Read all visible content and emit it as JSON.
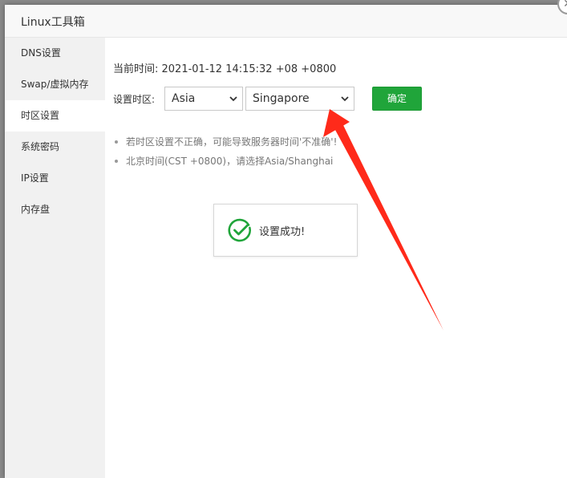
{
  "window": {
    "title": "Linux工具箱",
    "close_glyph": "✕"
  },
  "sidebar": {
    "items": [
      {
        "label": "DNS设置"
      },
      {
        "label": "Swap/虚拟内存"
      },
      {
        "label": "时区设置"
      },
      {
        "label": "系统密码"
      },
      {
        "label": "IP设置"
      },
      {
        "label": "内存盘"
      }
    ],
    "active_index": 2
  },
  "main": {
    "current_time_label": "当前时间: 2021-01-12 14:15:32 +08 +0800",
    "timezone_label": "设置时区:",
    "region_select": {
      "value": "Asia"
    },
    "city_select": {
      "value": "Singapore"
    },
    "confirm_label": "确定",
    "tips": [
      "若时区设置不正确，可能导致服务器时间'不准确'!",
      "北京时间(CST +0800)，请选择Asia/Shanghai"
    ]
  },
  "toast": {
    "message": "设置成功!",
    "icon": "check-circle-icon"
  },
  "colors": {
    "accent": "#20a53a",
    "annotation_arrow": "#ff2a1a"
  }
}
